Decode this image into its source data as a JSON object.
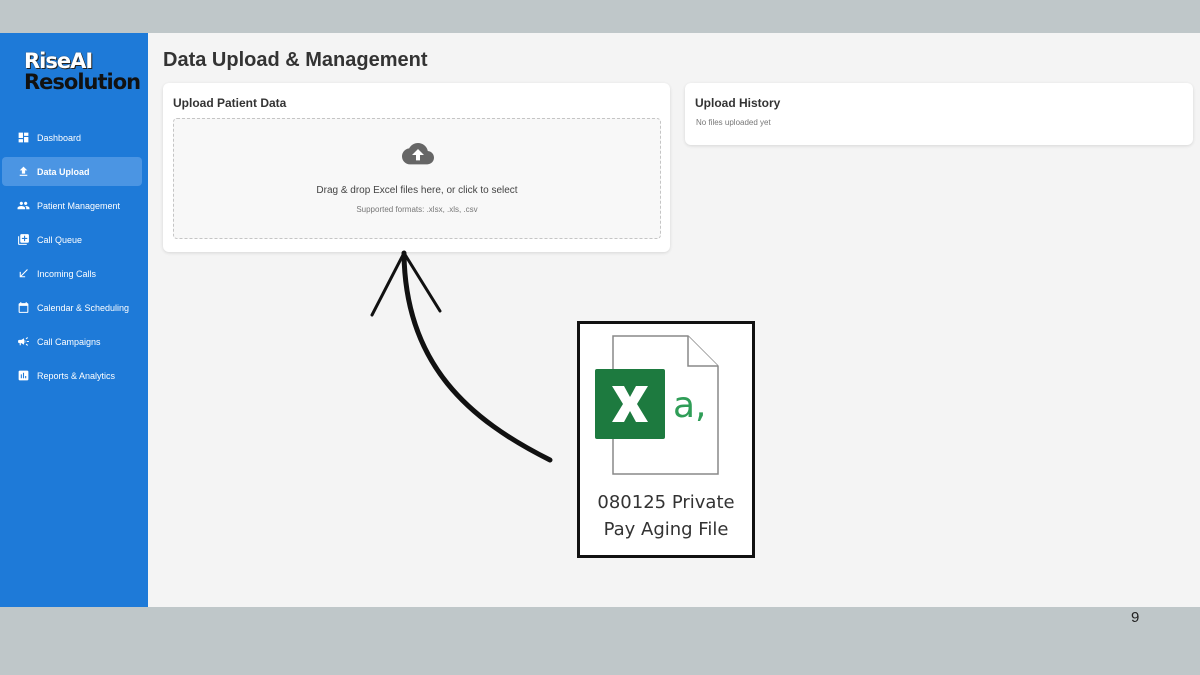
{
  "brand": {
    "line1": "RiseAI",
    "line2": "Resolution"
  },
  "sidebar": {
    "items": [
      {
        "label": "Dashboard",
        "icon": "dashboard-icon"
      },
      {
        "label": "Data Upload",
        "icon": "upload-icon",
        "active": true
      },
      {
        "label": "Patient Management",
        "icon": "people-icon"
      },
      {
        "label": "Call Queue",
        "icon": "queue-icon"
      },
      {
        "label": "Incoming Calls",
        "icon": "incoming-call-icon"
      },
      {
        "label": "Calendar & Scheduling",
        "icon": "calendar-icon"
      },
      {
        "label": "Call Campaigns",
        "icon": "megaphone-icon"
      },
      {
        "label": "Reports & Analytics",
        "icon": "bar-chart-icon"
      }
    ]
  },
  "main": {
    "title": "Data Upload & Management",
    "upload_card": {
      "title": "Upload Patient Data",
      "dropzone_text": "Drag & drop Excel files here, or click to select",
      "supported_formats": "Supported formats: .xlsx, .xls, .csv"
    },
    "history_card": {
      "title": "Upload History",
      "empty_text": "No files uploaded yet"
    }
  },
  "overlay": {
    "file_icon": "excel-file-icon",
    "file_name_line1": "080125 Private",
    "file_name_line2": "Pay Aging File"
  },
  "slide_number": "9",
  "colors": {
    "sidebar": "#1e7ad8",
    "sidebar_active": "#4b95e3",
    "excel_green": "#1d7a3f",
    "background": "#f4f4f4"
  }
}
